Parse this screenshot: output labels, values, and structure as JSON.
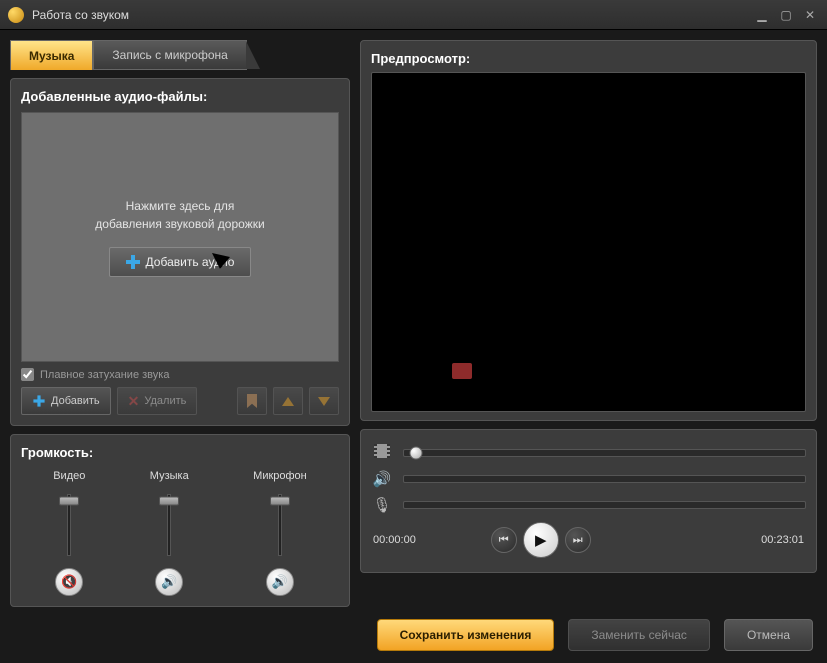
{
  "window": {
    "title": "Работа со звуком"
  },
  "tabs": {
    "music": "Музыка",
    "mic": "Запись с микрофона"
  },
  "audio_panel": {
    "title": "Добавленные аудио-файлы:",
    "hint_line1": "Нажмите здесь для",
    "hint_line2": "добавления звуковой дорожки",
    "add_button": "Добавить аудио",
    "fade_label": "Плавное затухание звука"
  },
  "toolbar": {
    "add": "Добавить",
    "delete": "Удалить"
  },
  "volume": {
    "title": "Громкость:",
    "video": "Видео",
    "music": "Музыка",
    "mic": "Микрофон"
  },
  "preview": {
    "title": "Предпросмотр:"
  },
  "playback": {
    "current": "00:00:00",
    "total": "00:23:01"
  },
  "footer": {
    "save": "Сохранить изменения",
    "replace": "Заменить сейчас",
    "cancel": "Отмена"
  }
}
